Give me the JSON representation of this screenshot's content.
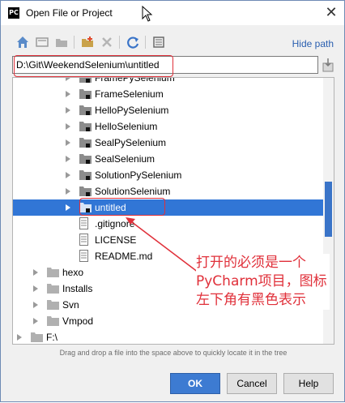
{
  "window": {
    "title": "Open File or Project",
    "close_glyph": "✕"
  },
  "toolbar": {
    "buttons": [
      {
        "name": "home-icon",
        "interactable": true
      },
      {
        "name": "desktop-icon",
        "interactable": true
      },
      {
        "name": "project-folder-icon",
        "interactable": true
      },
      {
        "name": "new-folder-icon",
        "interactable": true
      },
      {
        "name": "delete-icon",
        "interactable": true
      },
      {
        "name": "refresh-icon",
        "interactable": true
      },
      {
        "name": "show-hidden-icon",
        "interactable": true
      }
    ],
    "hide_path_label": "Hide path"
  },
  "path": {
    "value": "D:\\Git\\WeekendSelenium\\untitled"
  },
  "tree": {
    "rows": [
      {
        "label": "FramePySelenium",
        "level": 2,
        "type": "project",
        "expandable": true,
        "selected": false
      },
      {
        "label": "FrameSelenium",
        "level": 2,
        "type": "project",
        "expandable": true,
        "selected": false
      },
      {
        "label": "HelloPySelenium",
        "level": 2,
        "type": "project",
        "expandable": true,
        "selected": false
      },
      {
        "label": "HelloSelenium",
        "level": 2,
        "type": "project",
        "expandable": true,
        "selected": false
      },
      {
        "label": "SealPySelenium",
        "level": 2,
        "type": "project",
        "expandable": true,
        "selected": false
      },
      {
        "label": "SealSelenium",
        "level": 2,
        "type": "project",
        "expandable": true,
        "selected": false
      },
      {
        "label": "SolutionPySelenium",
        "level": 2,
        "type": "project",
        "expandable": true,
        "selected": false
      },
      {
        "label": "SolutionSelenium",
        "level": 2,
        "type": "project",
        "expandable": true,
        "selected": false
      },
      {
        "label": "untitled",
        "level": 2,
        "type": "project",
        "expandable": true,
        "selected": true
      },
      {
        "label": ".gitignore",
        "level": 2,
        "type": "file",
        "expandable": false,
        "selected": false
      },
      {
        "label": "LICENSE",
        "level": 2,
        "type": "file",
        "expandable": false,
        "selected": false
      },
      {
        "label": "README.md",
        "level": 2,
        "type": "file",
        "expandable": false,
        "selected": false
      },
      {
        "label": "hexo",
        "level": 1,
        "type": "folder",
        "expandable": true,
        "selected": false
      },
      {
        "label": "Installs",
        "level": 1,
        "type": "folder",
        "expandable": true,
        "selected": false
      },
      {
        "label": "Svn",
        "level": 1,
        "type": "folder",
        "expandable": true,
        "selected": false
      },
      {
        "label": "Vmpod",
        "level": 1,
        "type": "folder",
        "expandable": true,
        "selected": false
      },
      {
        "label": "F:\\",
        "level": 0,
        "type": "drive",
        "expandable": true,
        "selected": false
      }
    ]
  },
  "hint": "Drag and drop a file into the space above to quickly locate it in the tree",
  "buttons": {
    "ok": "OK",
    "cancel": "Cancel",
    "help": "Help"
  },
  "annotation": {
    "text": "打开的必须是一个PyCharm项目，图标左下角有黑色表示",
    "color": "#e0303a"
  },
  "colors": {
    "selection": "#3176d6",
    "link": "#2a5fb0",
    "accent_button": "#3d7bd2"
  }
}
